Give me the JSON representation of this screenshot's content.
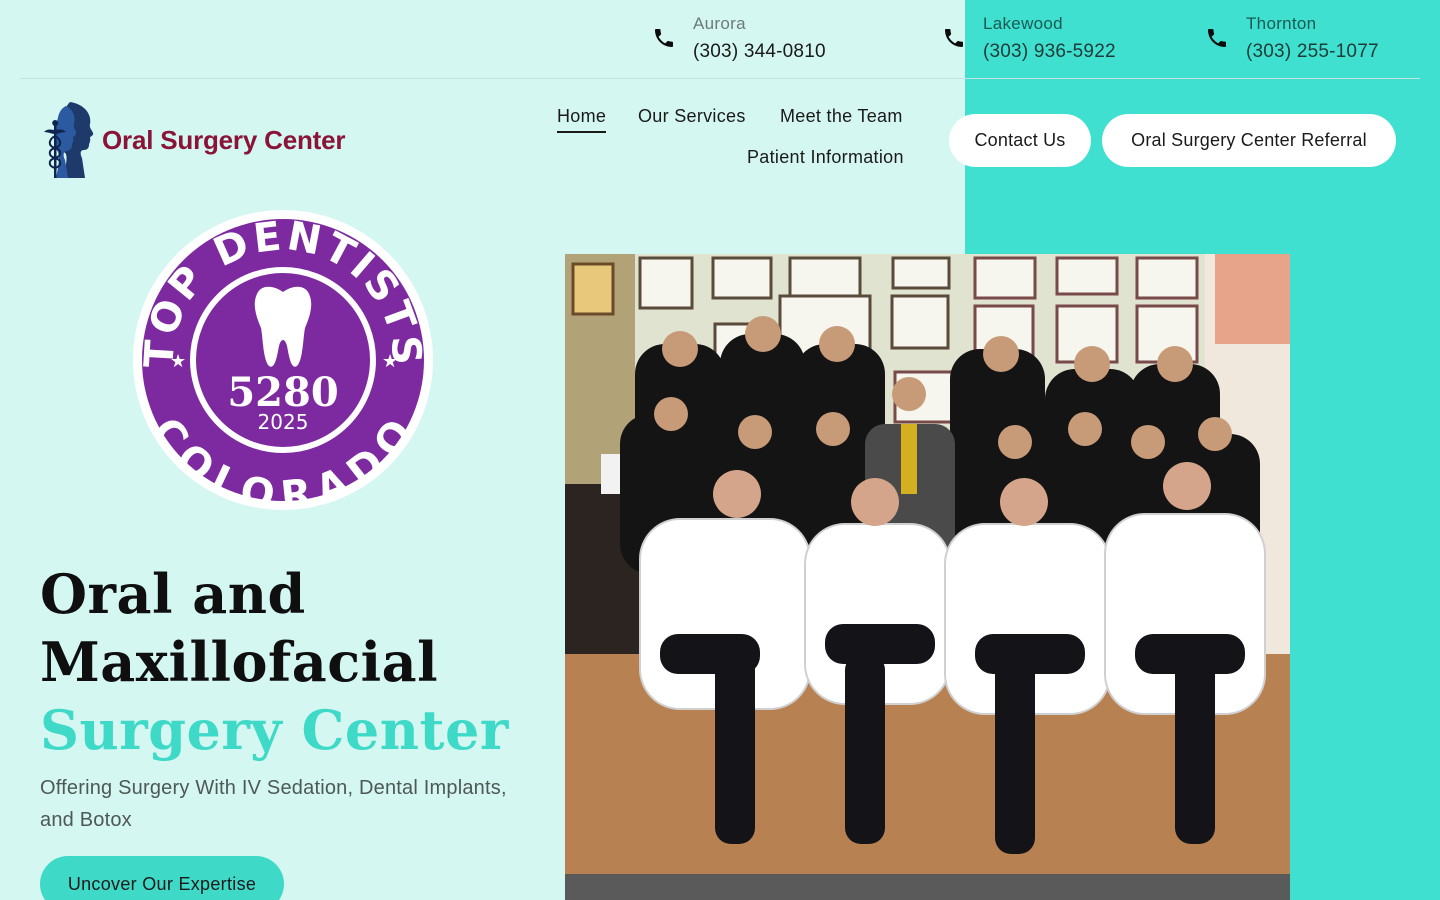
{
  "locations": [
    {
      "city": "Aurora",
      "phone": "(303) 344-0810"
    },
    {
      "city": "Lakewood",
      "phone": "(303) 936-5922"
    },
    {
      "city": "Thornton",
      "phone": "(303) 255-1077"
    }
  ],
  "logo": {
    "brand": "Oral Surgery Center"
  },
  "nav": {
    "home": "Home",
    "services": "Our Services",
    "team": "Meet the Team",
    "patient": "Patient Information"
  },
  "buttons": {
    "contact": "Contact Us",
    "referral": "Oral Surgery Center Referral"
  },
  "badge": {
    "top_text": "TOP DENTISTS",
    "bottom_text": "COLORADO",
    "number": "5280",
    "year": "2025"
  },
  "hero": {
    "line1": "Oral and",
    "line2": "Maxillofacial",
    "line3": "Surgery Center",
    "subtitle": "Offering Surgery With IV Sedation, Dental Implants, and Botox",
    "cta": "Uncover Our Expertise"
  },
  "colors": {
    "background": "#d4f7f2",
    "teal": "#3fe0cf",
    "brand": "#8a1437",
    "badge_purple": "#7d2aa0"
  }
}
